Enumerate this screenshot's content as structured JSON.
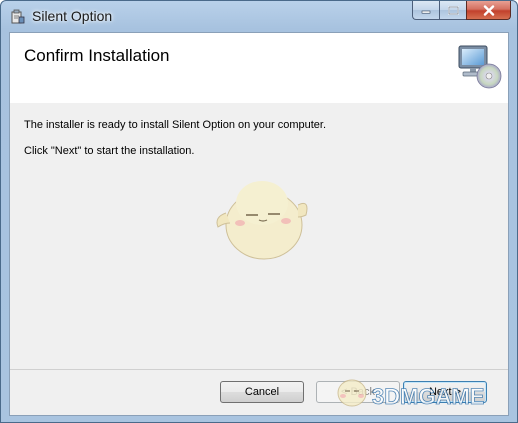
{
  "window": {
    "title": "Silent Option"
  },
  "banner": {
    "title": "Confirm Installation",
    "icon": "computer-cd-icon"
  },
  "body": {
    "line1": "The installer is ready to install Silent Option on your computer.",
    "line2": "Click \"Next\" to start the installation."
  },
  "buttons": {
    "cancel": "Cancel",
    "back": "< Back",
    "next": "Next >"
  },
  "watermark": {
    "logo_text": "3DMGAME"
  },
  "colors": {
    "titlebar": "#a9c4e0",
    "client_bg": "#f0f0f0",
    "close_red": "#c2412c",
    "next_border": "#3c7fb1"
  }
}
